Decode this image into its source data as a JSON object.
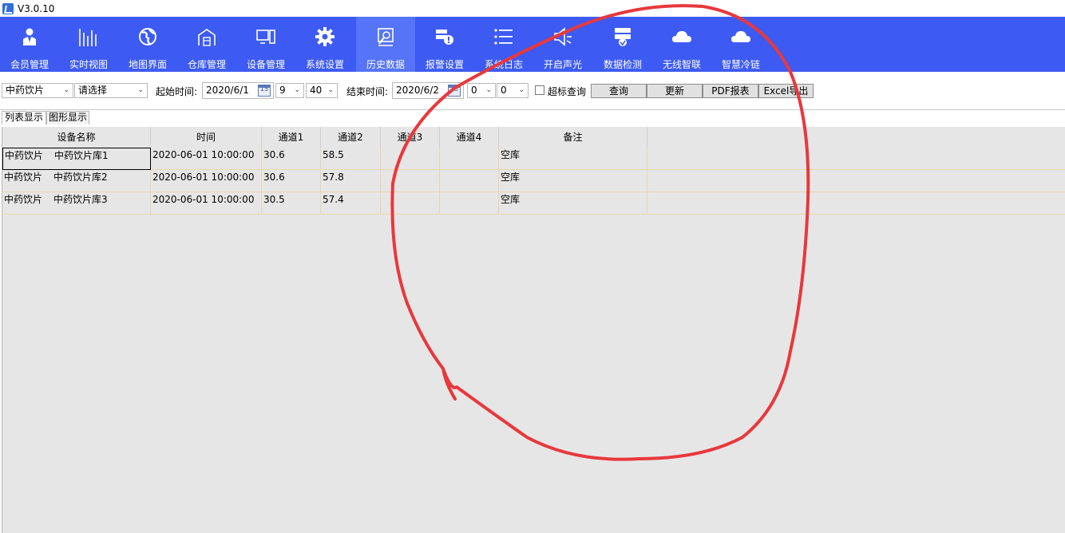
{
  "app": {
    "version": "V3.0.10"
  },
  "toolbar": [
    {
      "label": "会员管理",
      "icon": "member-icon"
    },
    {
      "label": "实时视图",
      "icon": "realtime-chart-icon"
    },
    {
      "label": "地图界面",
      "icon": "globe-icon"
    },
    {
      "label": "仓库管理",
      "icon": "warehouse-icon"
    },
    {
      "label": "设备管理",
      "icon": "device-icon"
    },
    {
      "label": "系统设置",
      "icon": "gear-icon"
    },
    {
      "label": "历史数据",
      "icon": "history-icon",
      "active": true
    },
    {
      "label": "报警设置",
      "icon": "alarm-icon"
    },
    {
      "label": "系统日志",
      "icon": "list-icon"
    },
    {
      "label": "开启声光",
      "icon": "speaker-icon"
    },
    {
      "label": "数据检测",
      "icon": "database-icon"
    },
    {
      "label": "无线智联",
      "icon": "cloud-icon"
    },
    {
      "label": "智慧冷链",
      "icon": "cloud-icon"
    }
  ],
  "filters": {
    "device_select": "中药饮片",
    "sub_select": "请选择",
    "start_label": "起始时间:",
    "start_date": "2020/6/1",
    "start_hour": "9",
    "start_minute": "40",
    "end_label": "结束时间:",
    "end_date": "2020/6/2",
    "end_hour": "0",
    "end_minute": "0",
    "over_limit_label": "超标查询",
    "calendar_day": "15",
    "buttons": {
      "query": "查询",
      "refresh": "更新",
      "pdf": "PDF报表",
      "excel": "Excel导出"
    }
  },
  "tabs": [
    {
      "label": "列表显示",
      "active": true
    },
    {
      "label": "图形显示"
    }
  ],
  "table": {
    "columns": [
      "设备名称",
      "时间",
      "通道1",
      "通道2",
      "通道3",
      "通道4",
      "备注"
    ],
    "rows": [
      {
        "device": "中药饮片",
        "warehouse": "中药饮片库1",
        "time": "2020-06-01 10:00:00",
        "ch1": "30.6",
        "ch2": "58.5",
        "ch3": "",
        "ch4": "",
        "note": "空库"
      },
      {
        "device": "中药饮片",
        "warehouse": "中药饮片库2",
        "time": "2020-06-01 10:00:00",
        "ch1": "30.6",
        "ch2": "57.8",
        "ch3": "",
        "ch4": "",
        "note": "空库"
      },
      {
        "device": "中药饮片",
        "warehouse": "中药饮片库3",
        "time": "2020-06-01 10:00:00",
        "ch1": "30.5",
        "ch2": "57.4",
        "ch3": "",
        "ch4": "",
        "note": "空库"
      }
    ]
  },
  "colors": {
    "toolbar_bg": "#3d5bf3",
    "annotation": "#e8383c"
  }
}
